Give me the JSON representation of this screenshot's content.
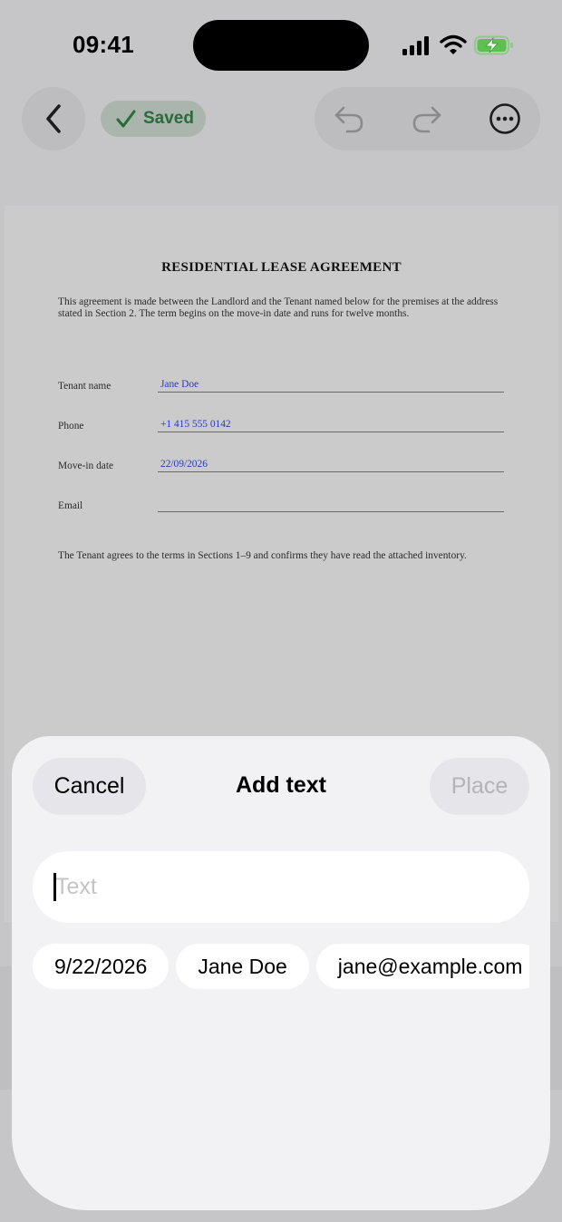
{
  "status_bar": {
    "time": "09:41",
    "icons": [
      "cellular-signal-icon",
      "wifi-icon",
      "battery-charging-icon"
    ]
  },
  "toolbar": {
    "back_icon": "chevron-left-icon",
    "saved_label": "Saved",
    "saved_icon": "checkmark-icon",
    "undo_icon": "undo-icon",
    "redo_icon": "redo-icon",
    "more_icon": "ellipsis-circle-icon",
    "saved_color": "#2a6b3a"
  },
  "document": {
    "title": "RESIDENTIAL LEASE AGREEMENT",
    "intro": "This agreement is made between the Landlord and the Tenant named below for the premises at the address stated in Section 2. The term begins on the move-in date and runs for twelve months.",
    "fields": [
      {
        "label": "Tenant name",
        "value": "Jane Doe"
      },
      {
        "label": "Phone",
        "value": "+1 415 555 0142"
      },
      {
        "label": "Move-in date",
        "value": "22/09/2026"
      },
      {
        "label": "Email",
        "value": ""
      }
    ],
    "footer": "The Tenant agrees to the terms in Sections 1–9 and confirms they have read the attached inventory.",
    "field_value_color": "#2c3ab5"
  },
  "sheet": {
    "cancel_label": "Cancel",
    "title": "Add text",
    "place_label": "Place",
    "input": {
      "value": "",
      "placeholder": "Text"
    },
    "suggestions": [
      "9/22/2026",
      "Jane Doe",
      "jane@example.com"
    ]
  }
}
